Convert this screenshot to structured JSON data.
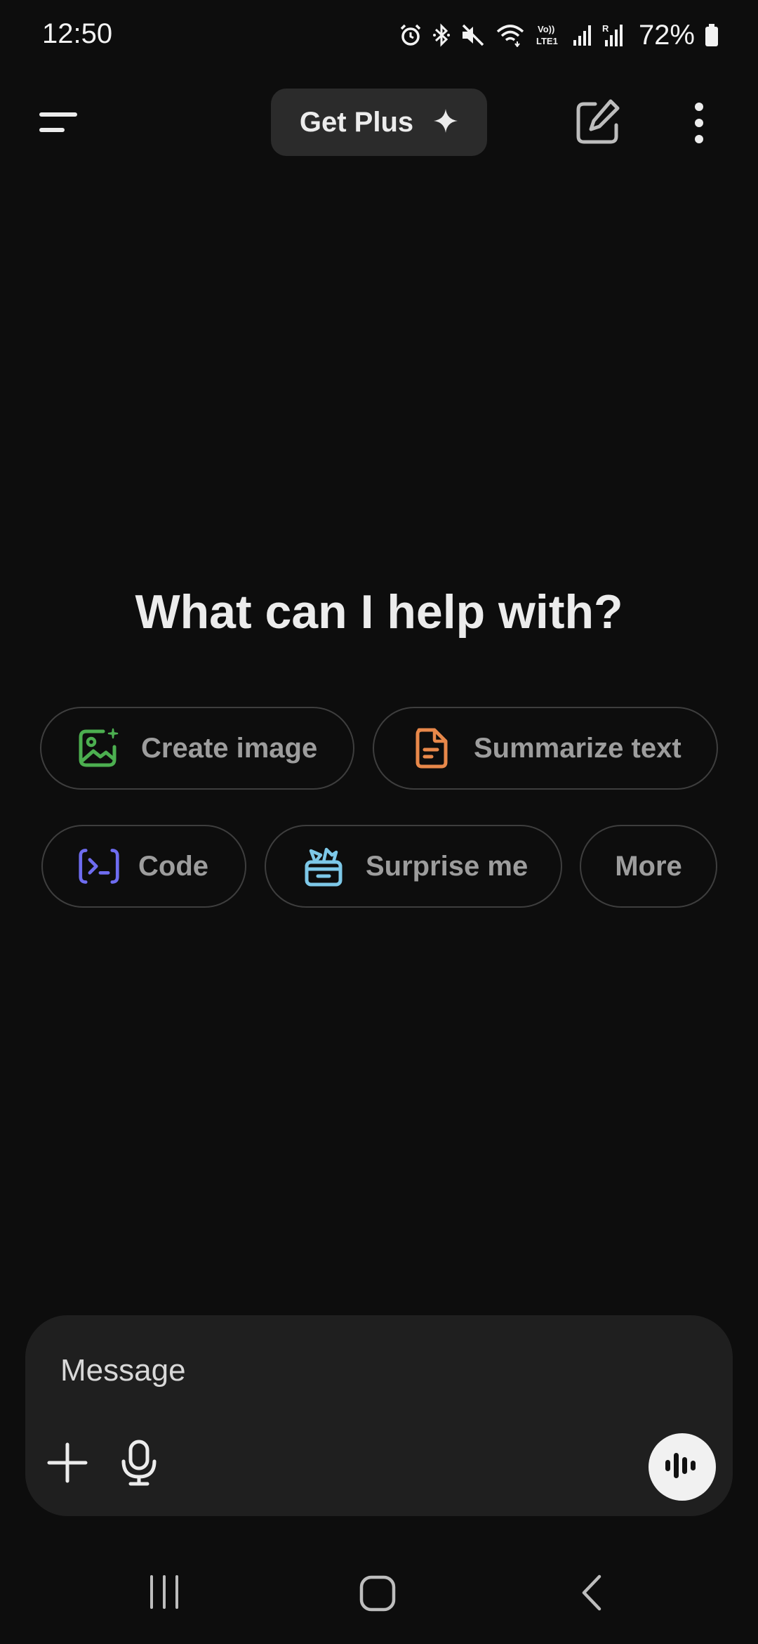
{
  "status_bar": {
    "time": "12:50",
    "battery": "72%",
    "icons": [
      "alarm-icon",
      "bluetooth-icon",
      "mute-icon",
      "wifi-icon",
      "volte-icon",
      "signal-icon",
      "signal-roaming-icon",
      "battery-icon"
    ]
  },
  "header": {
    "menu_icon": "menu-icon",
    "get_plus_label": "Get Plus",
    "sparkle_icon": "sparkle-icon",
    "new_chat_icon": "edit-icon",
    "more_icon": "more-vertical-icon"
  },
  "main": {
    "headline": "What can I help with?",
    "suggestions": [
      {
        "label": "Create image",
        "icon": "image-icon",
        "color": "#4caf50"
      },
      {
        "label": "Summarize text",
        "icon": "document-icon",
        "color": "#e8884a"
      },
      {
        "label": "Code",
        "icon": "terminal-icon",
        "color": "#6e6cf0"
      },
      {
        "label": "Surprise me",
        "icon": "gift-icon",
        "color": "#7dc8e8"
      },
      {
        "label": "More",
        "icon": "",
        "color": ""
      }
    ]
  },
  "composer": {
    "placeholder": "Message",
    "attach_icon": "plus-icon",
    "mic_icon": "microphone-icon",
    "voice_icon": "voice-waveform-icon"
  },
  "nav_bar": {
    "items": [
      "recents-icon",
      "home-icon",
      "back-icon"
    ]
  },
  "colors": {
    "background": "#0d0d0d",
    "surface": "#1f1f1f",
    "chip_border": "#3e3e3e",
    "text": "#ececec"
  }
}
